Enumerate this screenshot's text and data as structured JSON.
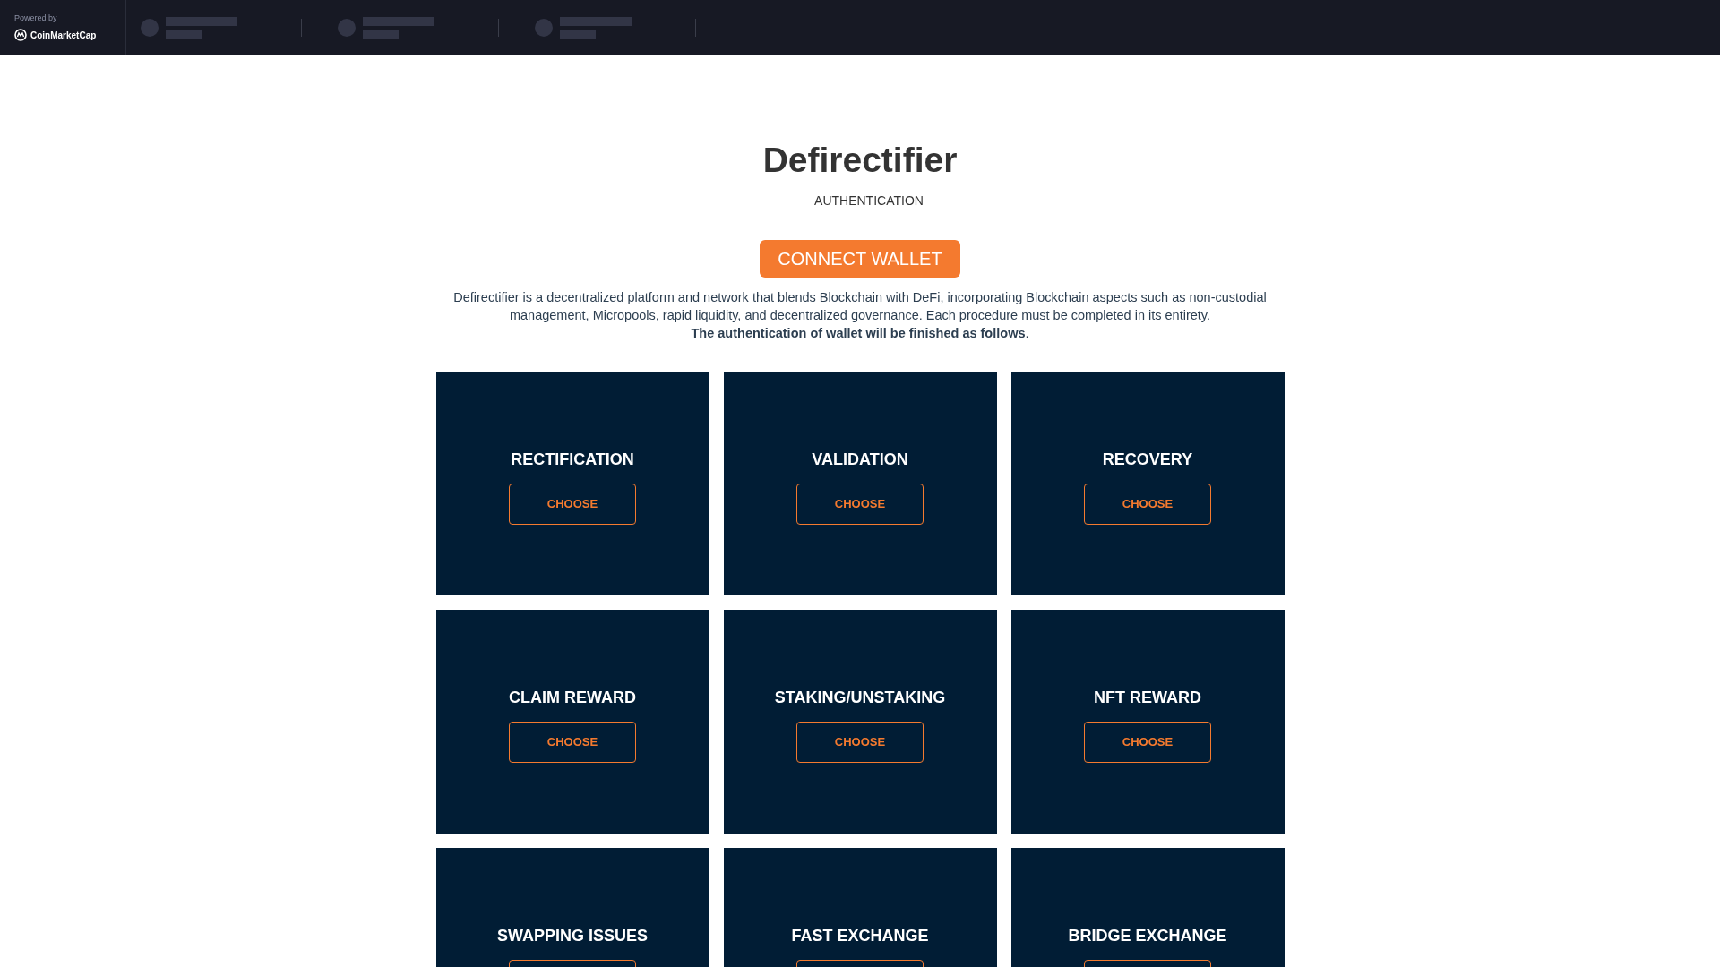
{
  "ticker": {
    "powered_by": "Powered by",
    "brand": "CoinMarketCap",
    "coins": [
      {
        "kind": "placeholder"
      },
      {
        "kind": "placeholder"
      },
      {
        "kind": "placeholder"
      }
    ]
  },
  "title": "Defirectifier",
  "subtitle": "AUTHENTICATION",
  "connect_button": "CONNECT WALLET",
  "intro": "Defirectifier is a decentralized platform and network that blends Blockchain with DeFi, incorporating Blockchain aspects such as non-custodial management, Micropools, rapid liquidity, and decentralized governance. Each procedure must be completed in its entirety.",
  "intro_bold": "**The authentication of wallet will be finished as follows**.",
  "cards": [
    {
      "title": "RECTIFICATION",
      "button": "CHOOSE"
    },
    {
      "title": "VALIDATION",
      "button": "CHOOSE"
    },
    {
      "title": "RECOVERY",
      "button": "CHOOSE"
    },
    {
      "title": "CLAIM REWARD",
      "button": "CHOOSE"
    },
    {
      "title": "STAKING/UNSTAKING",
      "button": "CHOOSE"
    },
    {
      "title": "NFT REWARD",
      "button": "CHOOSE"
    },
    {
      "title": "SWAPPING ISSUES"
    },
    {
      "title": "FAST EXCHANGE"
    },
    {
      "title": "BRIDGE EXCHANGE"
    }
  ]
}
